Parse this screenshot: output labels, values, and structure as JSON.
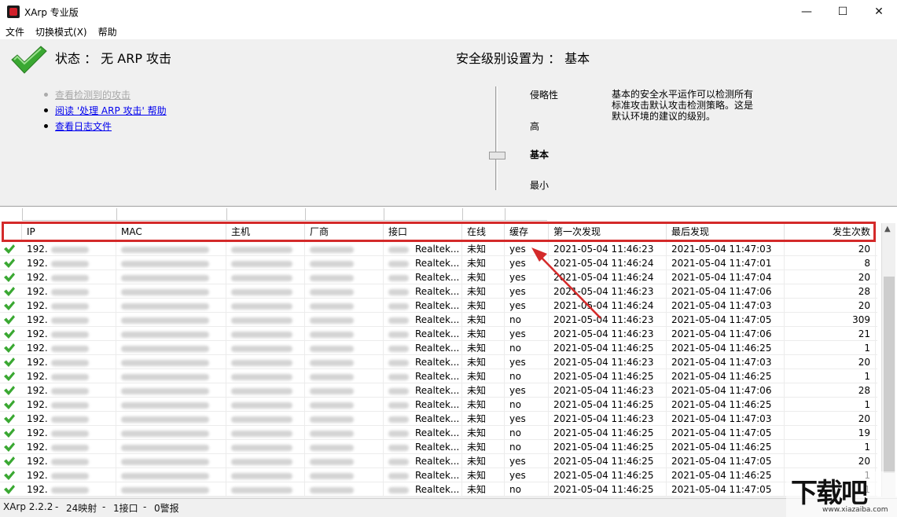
{
  "window": {
    "title": "XArp 专业版",
    "controls": {
      "minimize": "—",
      "maximize": "☐",
      "close": "✕"
    }
  },
  "menu": [
    "文件",
    "切换模式(X)",
    "帮助"
  ],
  "status": {
    "text": "状态 ： 无 ARP 攻击",
    "security_level": "安全级别设置为 ： 基本"
  },
  "links": [
    {
      "label": "查看检测到的攻击",
      "enabled": false
    },
    {
      "label": "阅读 '处理 ARP 攻击' 帮助",
      "enabled": true
    },
    {
      "label": "查看日志文件",
      "enabled": true
    }
  ],
  "levels": [
    "侵略性",
    "高",
    "基本",
    "最小"
  ],
  "selected_level": "基本",
  "level_description": "基本的安全水平运作可以检测所有标准攻击默认攻击检测策略。这是默认环境的建议的级别。",
  "table": {
    "columns": [
      "IP",
      "MAC",
      "主机",
      "厂商",
      "接口",
      "在线",
      "缓存",
      "第一次发现",
      "最后发现",
      "发生次数"
    ],
    "rows": [
      {
        "ip": "192.",
        "iface": "Realtek...",
        "online": "未知",
        "cache": "yes",
        "first": "2021-05-04 11:46:23",
        "last": "2021-05-04 11:47:03",
        "count": "20"
      },
      {
        "ip": "192.",
        "iface": "Realtek...",
        "online": "未知",
        "cache": "yes",
        "first": "2021-05-04 11:46:24",
        "last": "2021-05-04 11:47:01",
        "count": "8"
      },
      {
        "ip": "192.",
        "iface": "Realtek...",
        "online": "未知",
        "cache": "yes",
        "first": "2021-05-04 11:46:24",
        "last": "2021-05-04 11:47:04",
        "count": "20"
      },
      {
        "ip": "192.",
        "iface": "Realtek...",
        "online": "未知",
        "cache": "yes",
        "first": "2021-05-04 11:46:23",
        "last": "2021-05-04 11:47:06",
        "count": "28"
      },
      {
        "ip": "192.",
        "iface": "Realtek...",
        "online": "未知",
        "cache": "yes",
        "first": "2021-05-04 11:46:24",
        "last": "2021-05-04 11:47:03",
        "count": "20"
      },
      {
        "ip": "192.",
        "iface": "Realtek...",
        "online": "未知",
        "cache": "no",
        "first": "2021-05-04 11:46:23",
        "last": "2021-05-04 11:47:05",
        "count": "309"
      },
      {
        "ip": "192.",
        "iface": "Realtek...",
        "online": "未知",
        "cache": "yes",
        "first": "2021-05-04 11:46:23",
        "last": "2021-05-04 11:47:06",
        "count": "21"
      },
      {
        "ip": "192.",
        "iface": "Realtek...",
        "online": "未知",
        "cache": "no",
        "first": "2021-05-04 11:46:25",
        "last": "2021-05-04 11:46:25",
        "count": "1"
      },
      {
        "ip": "192.",
        "iface": "Realtek...",
        "online": "未知",
        "cache": "yes",
        "first": "2021-05-04 11:46:23",
        "last": "2021-05-04 11:47:03",
        "count": "20"
      },
      {
        "ip": "192.",
        "iface": "Realtek...",
        "online": "未知",
        "cache": "no",
        "first": "2021-05-04 11:46:25",
        "last": "2021-05-04 11:46:25",
        "count": "1"
      },
      {
        "ip": "192.",
        "iface": "Realtek...",
        "online": "未知",
        "cache": "yes",
        "first": "2021-05-04 11:46:23",
        "last": "2021-05-04 11:47:06",
        "count": "28"
      },
      {
        "ip": "192.",
        "iface": "Realtek...",
        "online": "未知",
        "cache": "no",
        "first": "2021-05-04 11:46:25",
        "last": "2021-05-04 11:46:25",
        "count": "1"
      },
      {
        "ip": "192.",
        "iface": "Realtek...",
        "online": "未知",
        "cache": "yes",
        "first": "2021-05-04 11:46:23",
        "last": "2021-05-04 11:47:03",
        "count": "20"
      },
      {
        "ip": "192.",
        "iface": "Realtek...",
        "online": "未知",
        "cache": "no",
        "first": "2021-05-04 11:46:25",
        "last": "2021-05-04 11:47:05",
        "count": "19"
      },
      {
        "ip": "192.",
        "iface": "Realtek...",
        "online": "未知",
        "cache": "no",
        "first": "2021-05-04 11:46:25",
        "last": "2021-05-04 11:46:25",
        "count": "1"
      },
      {
        "ip": "192.",
        "iface": "Realtek...",
        "online": "未知",
        "cache": "yes",
        "first": "2021-05-04 11:46:25",
        "last": "2021-05-04 11:47:05",
        "count": "20"
      },
      {
        "ip": "192.",
        "iface": "Realtek...",
        "online": "未知",
        "cache": "yes",
        "first": "2021-05-04 11:46:25",
        "last": "2021-05-04 11:46:25",
        "count": "1"
      },
      {
        "ip": "192.",
        "iface": "Realtek...",
        "online": "未知",
        "cache": "no",
        "first": "2021-05-04 11:46:25",
        "last": "2021-05-04 11:47:05",
        "count": "1"
      }
    ]
  },
  "statusbar": {
    "version": "XArp 2.2.2",
    "mappings": "24映射",
    "interfaces": "1接口",
    "alerts": "0警报"
  },
  "watermark": {
    "main": "下载吧",
    "sub": "www.xiazaiba.com"
  },
  "colors": {
    "check_green": "#3aa832",
    "highlight_red": "#d42a2a",
    "link_blue": "#0000ee"
  }
}
